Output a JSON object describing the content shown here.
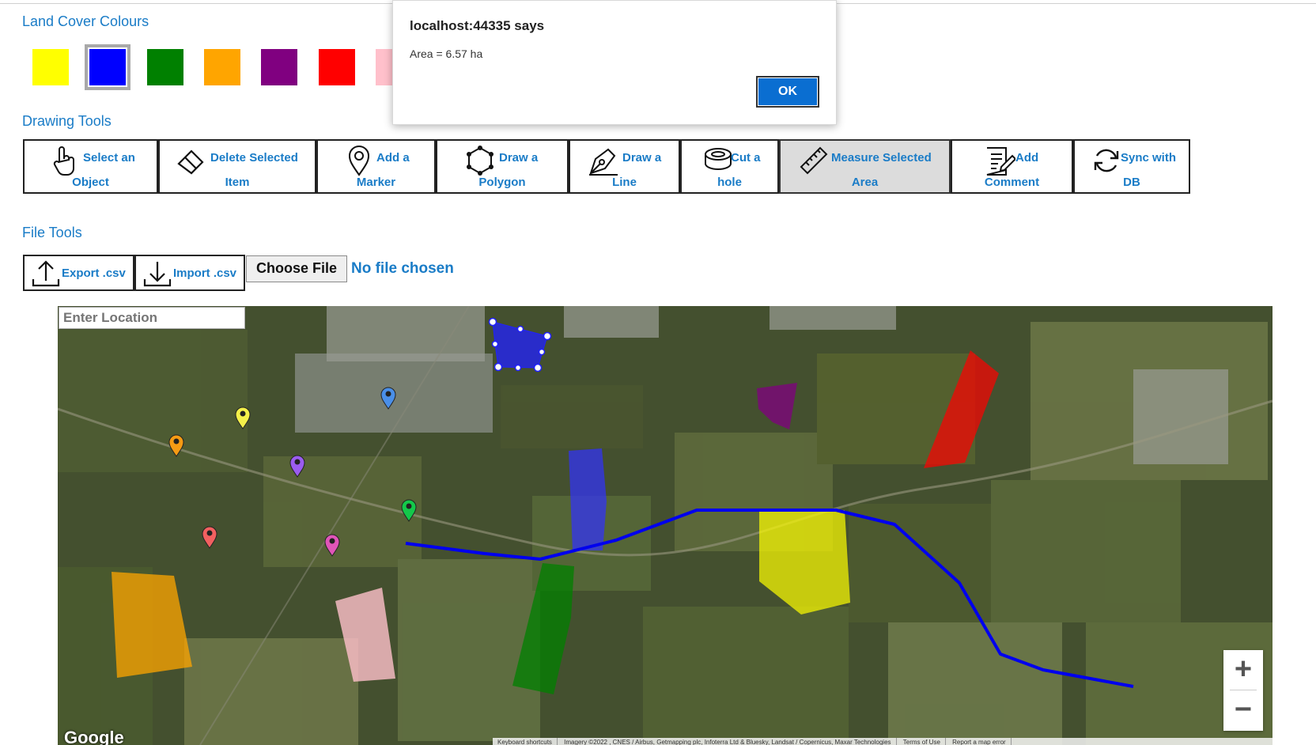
{
  "land_cover": {
    "title": "Land Cover Colours",
    "swatches": [
      {
        "name": "yellow",
        "color": "#ffff00",
        "selected": false
      },
      {
        "name": "blue",
        "color": "#0000ff",
        "selected": true
      },
      {
        "name": "green",
        "color": "#008000",
        "selected": false
      },
      {
        "name": "orange",
        "color": "#ffa500",
        "selected": false
      },
      {
        "name": "purple",
        "color": "#800080",
        "selected": false
      },
      {
        "name": "red",
        "color": "#ff0000",
        "selected": false
      },
      {
        "name": "pink",
        "color": "#ffc0cb",
        "selected": false
      }
    ]
  },
  "drawing_tools": {
    "title": "Drawing Tools",
    "buttons": [
      {
        "l1": "Select an",
        "l2": "Object",
        "icon": "hand-pointer-icon"
      },
      {
        "l1": "Delete Selected",
        "l2": "Item",
        "icon": "eraser-icon"
      },
      {
        "l1": "Add a",
        "l2": "Marker",
        "icon": "map-pin-icon"
      },
      {
        "l1": "Draw a",
        "l2": "Polygon",
        "icon": "polygon-icon"
      },
      {
        "l1": "Draw a",
        "l2": "Line",
        "icon": "pen-nib-icon"
      },
      {
        "l1": "Cut a",
        "l2": "hole",
        "icon": "ring-hole-icon"
      },
      {
        "l1": "Measure Selected",
        "l2": "Area",
        "icon": "ruler-icon",
        "active": true
      },
      {
        "l1": "Add",
        "l2": "Comment",
        "icon": "note-edit-icon"
      },
      {
        "l1": "Sync with",
        "l2": "DB",
        "icon": "sync-icon"
      }
    ]
  },
  "file_tools": {
    "title": "File Tools",
    "export_label": "Export .csv",
    "import_label": "Import .csv",
    "choose_file_label": "Choose File",
    "no_file_text": "No file chosen"
  },
  "map": {
    "location_placeholder": "Enter Location",
    "zoom_in": "+",
    "zoom_out": "−",
    "google_logo": "Google",
    "attribution": [
      "Keyboard shortcuts",
      "Imagery ©2022 , CNES / Airbus, Getmapping plc, Infoterra Ltd & Bluesky, Landsat / Copernicus, Maxar Technologies",
      "Terms of Use",
      "Report a map error"
    ]
  },
  "dialog": {
    "title": "localhost:44335 says",
    "message": "Area = 6.57 ha",
    "ok_label": "OK"
  }
}
